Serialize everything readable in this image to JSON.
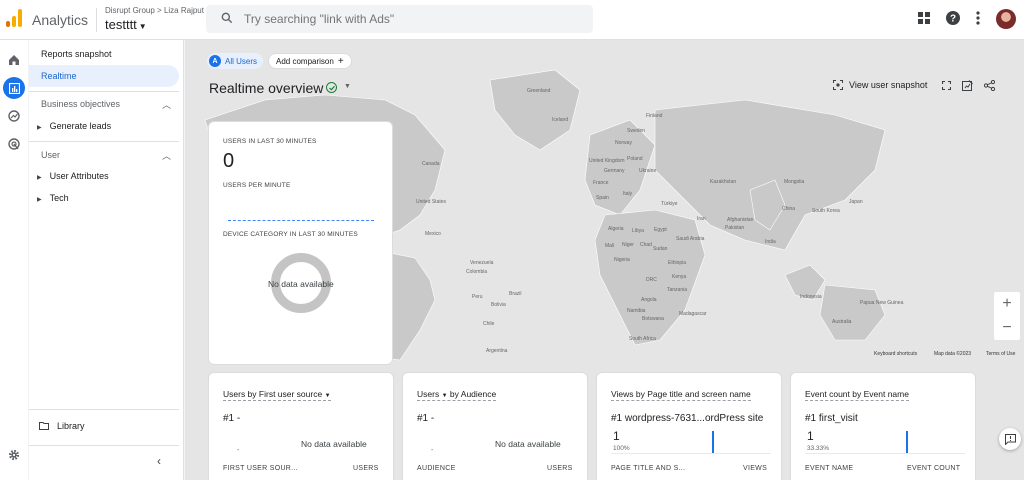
{
  "app": {
    "name": "Analytics",
    "account": "Disrupt Group",
    "account_user": "Liza Rajput",
    "property": "testttt"
  },
  "search": {
    "placeholder": "Try searching \"link with Ads\""
  },
  "nav": {
    "reports_snapshot": "Reports snapshot",
    "realtime": "Realtime",
    "business_objectives": "Business objectives",
    "generate_leads": "Generate leads",
    "user": "User",
    "user_attributes": "User Attributes",
    "tech": "Tech",
    "library": "Library"
  },
  "chips": {
    "all_users": "All Users",
    "all_users_letter": "A",
    "add_comparison": "Add comparison"
  },
  "page": {
    "title": "Realtime overview",
    "view_snapshot": "View user snapshot"
  },
  "map": {
    "footer": {
      "shortcuts": "Keyboard shortcuts",
      "map_data": "Map data ©2023",
      "terms": "Terms of Use"
    },
    "labels": [
      "Greenland",
      "Iceland",
      "Finland",
      "Sweden",
      "Norway",
      "Canada",
      "United Kingdom",
      "Poland",
      "Germany",
      "Ukraine",
      "France",
      "Kazakhstan",
      "Mongolia",
      "Spain",
      "Italy",
      "Türkiye",
      "Japan",
      "China",
      "South Korea",
      "United States",
      "Iran",
      "Afghanistan",
      "Pakistan",
      "Algeria",
      "Libya",
      "Egypt",
      "Saudi Arabia",
      "India",
      "Mexico",
      "Mali",
      "Niger",
      "Chad",
      "Sudan",
      "Nigeria",
      "Ethiopia",
      "Venezuela",
      "Colombia",
      "Kenya",
      "DRC",
      "Tanzania",
      "Peru",
      "Brazil",
      "Bolivia",
      "Angola",
      "Indonesia",
      "Papua New Guinea",
      "Namibia",
      "Madagascar",
      "Botswana",
      "South Africa",
      "Chile",
      "Australia",
      "Argentina"
    ]
  },
  "realtime_card": {
    "users_label": "USERS IN LAST 30 MINUTES",
    "users_value": "0",
    "per_minute_label": "USERS PER MINUTE",
    "device_label": "DEVICE CATEGORY IN LAST 30 MINUTES",
    "no_data": "No data available"
  },
  "cards": [
    {
      "title_prefix": "Users by ",
      "title_dim": "First user source",
      "rank": "#1  -",
      "dash": "-",
      "no_data": "No data available",
      "col1": "FIRST USER SOUR...",
      "col2": "USERS"
    },
    {
      "title_prefix": "Users",
      "title_dim": "by Audience",
      "rank": "#1  -",
      "dash": "-",
      "no_data": "No data available",
      "col1": "AUDIENCE",
      "col2": "USERS"
    },
    {
      "title": "Views by Page title and screen name",
      "rank": "#1  wordpress-7631...ordPress site",
      "value": "1",
      "pct": "100%",
      "col1": "PAGE TITLE AND S...",
      "col2": "VIEWS"
    },
    {
      "title": "Event count by Event name",
      "rank": "#1  first_visit",
      "value": "1",
      "pct": "33.33%",
      "col1": "EVENT NAME",
      "col2": "EVENT COUNT"
    }
  ],
  "colors": {
    "accent": "#1a73e8",
    "logo_orange": "#f9ab00",
    "logo_dark": "#e37400",
    "check_green": "#188038"
  }
}
